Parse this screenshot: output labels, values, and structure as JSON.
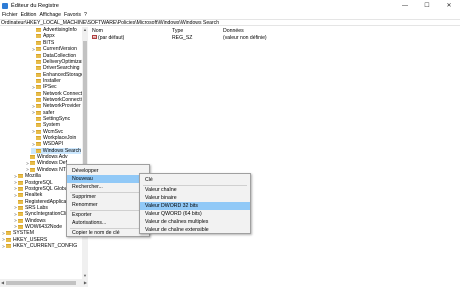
{
  "window": {
    "title": "Éditeur du Registre",
    "minimize": "—",
    "maximize": "☐",
    "close": "✕"
  },
  "menubar": [
    "Fichier",
    "Edition",
    "Affichage",
    "Favoris",
    "?"
  ],
  "address": "Ordinateur\\HKEY_LOCAL_MACHINE\\SOFTWARE\\Policies\\Microsoft\\Windows\\Windows Search",
  "tree": [
    {
      "label": "AdvertisingInfo",
      "exp": ""
    },
    {
      "label": "Appx",
      "exp": ""
    },
    {
      "label": "BITS",
      "exp": ""
    },
    {
      "label": "CurrentVersion",
      "exp": ">"
    },
    {
      "label": "DataCollection",
      "exp": ""
    },
    {
      "label": "DeliveryOptimizatio",
      "exp": ""
    },
    {
      "label": "DriverSearching",
      "exp": ""
    },
    {
      "label": "EnhancedStorageD",
      "exp": ""
    },
    {
      "label": "Installer",
      "exp": ""
    },
    {
      "label": "IPSec",
      "exp": ">"
    },
    {
      "label": "Network Connectio",
      "exp": ""
    },
    {
      "label": "NetworkConnectivi",
      "exp": ""
    },
    {
      "label": "NetworkProvider",
      "exp": ">"
    },
    {
      "label": "safer",
      "exp": ">"
    },
    {
      "label": "SettingSync",
      "exp": ""
    },
    {
      "label": "System",
      "exp": ""
    },
    {
      "label": "WcmSvc",
      "exp": ">"
    },
    {
      "label": "WorkplaceJoin",
      "exp": ""
    },
    {
      "label": "WSDAPI",
      "exp": ">"
    },
    {
      "label": "Windows Search",
      "exp": "",
      "selected": true
    },
    {
      "label": "Windows Adv",
      "exp": ""
    },
    {
      "label": "Windows Def",
      "exp": ">"
    },
    {
      "label": "Windows NT",
      "exp": ">"
    },
    {
      "label": "Mozilla",
      "exp": ">"
    },
    {
      "label": "PostgreSQL",
      "exp": ">"
    },
    {
      "label": "PostgreSQL Global",
      "exp": ">"
    },
    {
      "label": "Realtek",
      "exp": ">"
    },
    {
      "label": "RegisteredApplicati",
      "exp": ""
    },
    {
      "label": "SRS Labs",
      "exp": ">"
    },
    {
      "label": "SyncIntegrationClients",
      "exp": ">"
    },
    {
      "label": "Windows",
      "exp": ">"
    },
    {
      "label": "WOW6432Node",
      "exp": ">"
    },
    {
      "label": "SYSTEM",
      "exp": ">"
    },
    {
      "label": "HKEY_USERS",
      "exp": ">"
    },
    {
      "label": "HKEY_CURRENT_CONFIG",
      "exp": ">"
    }
  ],
  "list": {
    "headers": {
      "name": "Nom",
      "type": "Type",
      "data": "Données"
    },
    "rows": [
      {
        "icon": "ab",
        "name": "(par défaut)",
        "type": "REG_SZ",
        "data": "(valeur non définie)"
      }
    ]
  },
  "context_menu": {
    "items": [
      "Développer",
      "Nouveau",
      "Rechercher...",
      "Supprimer",
      "Renommer",
      "Exporter",
      "Autorisations...",
      "Copier le nom de clé"
    ],
    "submenu_marker": ">"
  },
  "submenu": {
    "items": [
      "Clé",
      "Valeur chaîne",
      "Valeur binaire",
      "Valeur DWORD 32 bits",
      "Valeur QWORD (64 bits)",
      "Valeur de chaînes multiples",
      "Valeur de chaîne extensible"
    ]
  },
  "scroll_arrows": {
    "up": "▲",
    "down": "▼",
    "left": "◀",
    "right": "▶"
  },
  "colors": {
    "selection": "#cce8ff",
    "menu_highlight": "#91c9f7",
    "folder": "#e8bd4a"
  }
}
